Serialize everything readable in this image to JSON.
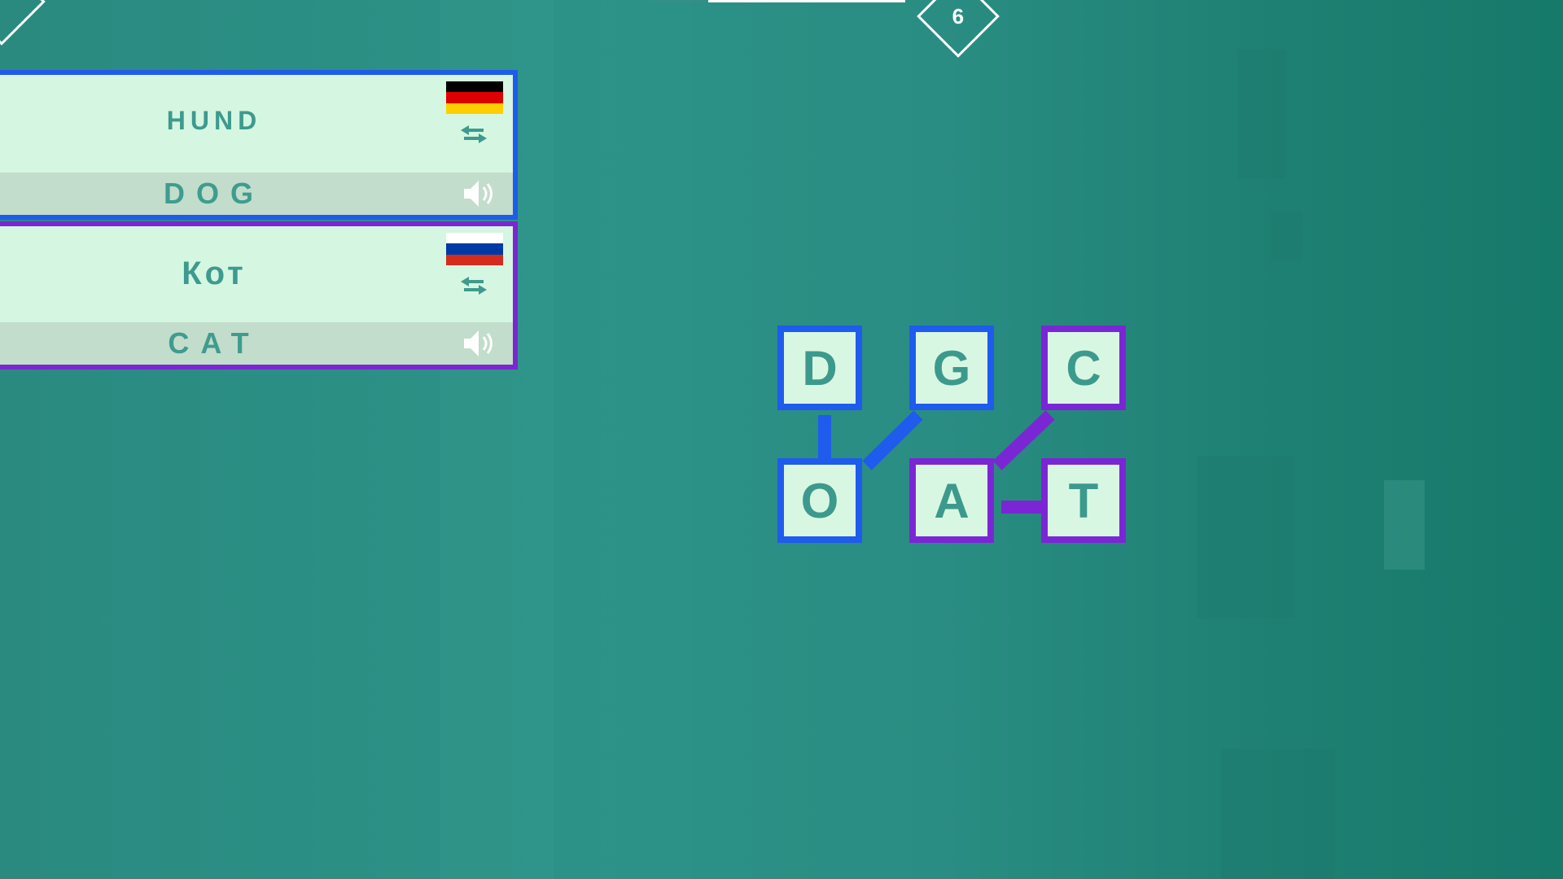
{
  "counter": {
    "value": "6"
  },
  "cards": [
    {
      "native_word": "HUND",
      "english_word": "DOG",
      "flag_icon": "germany-flag-icon",
      "flag_colors": [
        "#000000",
        "#dd0000",
        "#ffce00"
      ],
      "border_color": "#1f5bec"
    },
    {
      "native_word": "Кот",
      "english_word": "CAT",
      "flag_icon": "russia-flag-icon",
      "flag_colors": [
        "#ffffff",
        "#0039a6",
        "#d52b1e"
      ],
      "border_color": "#7b26d4"
    }
  ],
  "grid": {
    "tiles": [
      {
        "letter": "D",
        "color": "#1f5bec"
      },
      {
        "letter": "G",
        "color": "#1f5bec"
      },
      {
        "letter": "C",
        "color": "#7b26d4"
      },
      {
        "letter": "O",
        "color": "#1f5bec"
      },
      {
        "letter": "A",
        "color": "#7b26d4"
      },
      {
        "letter": "T",
        "color": "#7b26d4"
      }
    ]
  },
  "icons": {
    "swap": "swap-arrows-icon",
    "speaker": "speaker-icon"
  }
}
